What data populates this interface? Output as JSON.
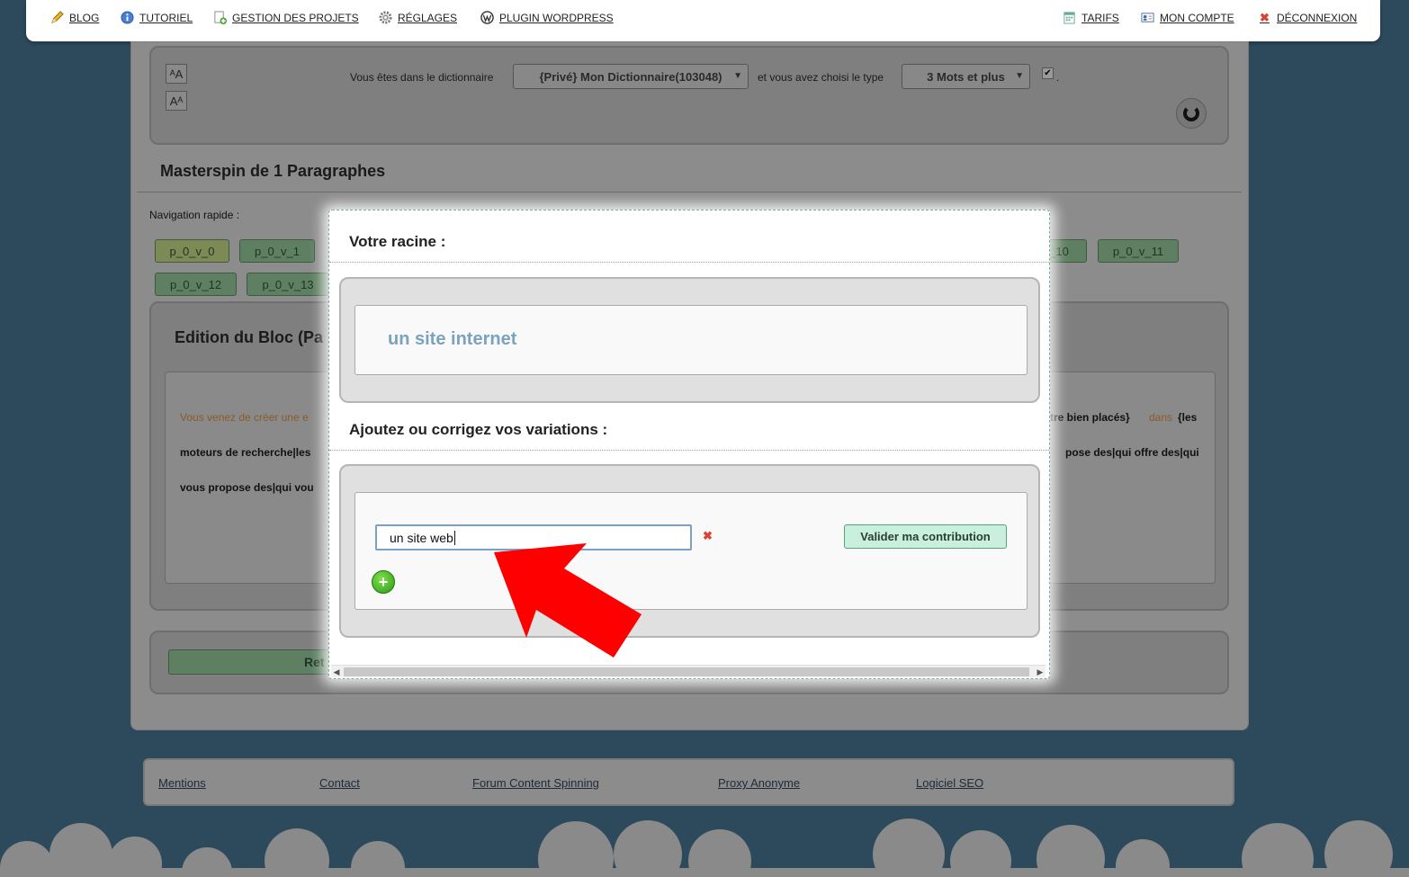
{
  "nav": {
    "left": [
      {
        "label": "BLOG",
        "icon": "pencil-icon"
      },
      {
        "label": "TUTORIEL",
        "icon": "info-icon"
      },
      {
        "label": "GESTION DES PROJETS",
        "icon": "add-document-icon"
      },
      {
        "label": "RÉGLAGES",
        "icon": "gear-icon"
      },
      {
        "label": "PLUGIN WORDPRESS",
        "icon": "wordpress-icon"
      }
    ],
    "right": [
      {
        "label": "TARIFS",
        "icon": "calendar-icon"
      },
      {
        "label": "MON COMPTE",
        "icon": "account-card-icon"
      },
      {
        "label": "DÉCONNEXION",
        "icon": "close-x-icon"
      }
    ]
  },
  "dictionary": {
    "prefix": "Vous êtes dans le dictionnaire",
    "dict_value": "{Privé} Mon Dictionnaire(103048)",
    "middle": "et vous avez choisi le type",
    "type_value": "3 Mots et plus",
    "suffix": "."
  },
  "page": {
    "title": "Masterspin de 1 Paragraphes",
    "nav_rapide_label": "Navigation rapide :",
    "nav_buttons_row1": [
      "p_0_v_0",
      "p_0_v_1"
    ],
    "nav_buttons_row1_right": [
      "_10",
      "p_0_v_11"
    ],
    "nav_buttons_row2": [
      "p_0_v_12",
      "p_0_v_13"
    ],
    "edition_title": "Edition du Bloc (Pa",
    "text_line1_left": "Vous venez de créer une e",
    "text_line1_right_a": "tre bien placés}",
    "text_line1_right_b": "dans",
    "text_line1_right_c": "{les",
    "text_line2_left": "moteurs de recherche|les",
    "text_line2_right": "pose des|qui offre des|qui",
    "text_line3_left": "vous propose des|qui vou",
    "bottom_button_label": "Ret"
  },
  "footer": {
    "links": [
      "Mentions",
      "Contact",
      "Forum Content Spinning",
      "Proxy Anonyme",
      "Logiciel SEO"
    ]
  },
  "modal": {
    "root_heading": "Votre racine :",
    "root_value": "un site internet",
    "variations_heading": "Ajoutez ou corrigez vos variations :",
    "variation_value": "un site web",
    "validate_label": "Valider ma contribution",
    "delete_glyph": "✖",
    "add_glyph": "+"
  },
  "colors": {
    "background": "#2c4a5c",
    "root_text": "#7aa3c0",
    "validate_bg": "#c8f0dc",
    "arrow": "#ff0000"
  }
}
